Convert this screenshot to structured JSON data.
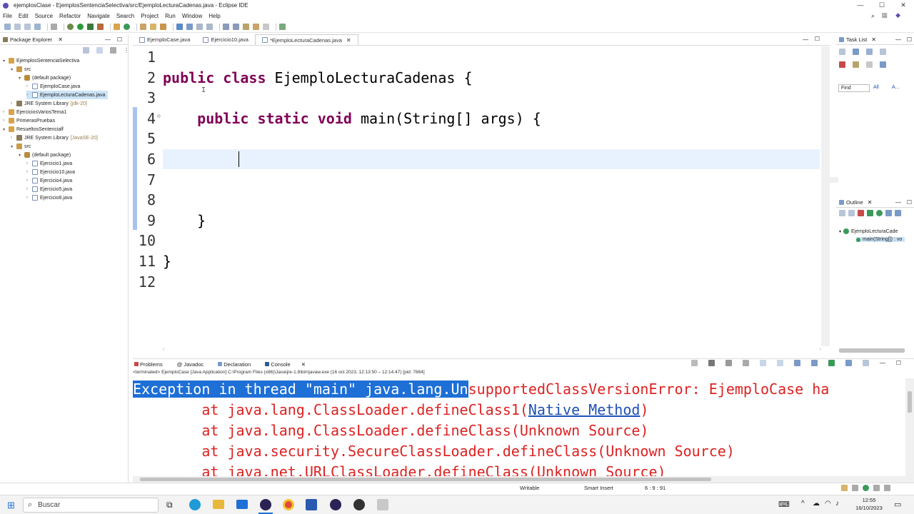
{
  "window": {
    "title": "ejemplosClase - EjemplosSentenciaSelectiva/src/EjemploLecturaCadenas.java - Eclipse IDE",
    "controls": [
      "—",
      "☐",
      "✕"
    ]
  },
  "menu": [
    "File",
    "Edit",
    "Source",
    "Refactor",
    "Navigate",
    "Search",
    "Project",
    "Run",
    "Window",
    "Help"
  ],
  "package_explorer": {
    "title": "Package Explorer",
    "tree": [
      {
        "label": "EjemplosSentenciaSelectiva",
        "depth": 0,
        "icon": "project",
        "expanded": true
      },
      {
        "label": "src",
        "depth": 1,
        "icon": "src",
        "expanded": true
      },
      {
        "label": "(default package)",
        "depth": 2,
        "icon": "package",
        "expanded": true
      },
      {
        "label": "EjemploCase.java",
        "depth": 3,
        "icon": "file",
        "expanded": false
      },
      {
        "label": "EjemploLecturaCadenas.java",
        "depth": 3,
        "icon": "file",
        "expanded": false,
        "selected": true
      },
      {
        "label": "JRE System Library",
        "suffix": "[jdk-20]",
        "depth": 1,
        "icon": "lib",
        "expanded": false
      },
      {
        "label": "EjerciciosVariosTema1",
        "depth": 0,
        "icon": "project",
        "expanded": false
      },
      {
        "label": "PrimerasPruebas",
        "depth": 0,
        "icon": "project",
        "expanded": false
      },
      {
        "label": "ResueltosSentencialf",
        "depth": 0,
        "icon": "project",
        "expanded": true
      },
      {
        "label": "JRE System Library",
        "suffix": "[JavaSE-20]",
        "depth": 1,
        "icon": "lib",
        "expanded": false
      },
      {
        "label": "src",
        "depth": 1,
        "icon": "src",
        "expanded": true
      },
      {
        "label": "(default package)",
        "depth": 2,
        "icon": "package",
        "expanded": true
      },
      {
        "label": "Ejercicio1.java",
        "depth": 3,
        "icon": "file",
        "expanded": false
      },
      {
        "label": "Ejercicio10.java",
        "depth": 3,
        "icon": "file",
        "expanded": false
      },
      {
        "label": "Ejercicio4.java",
        "depth": 3,
        "icon": "file",
        "expanded": false
      },
      {
        "label": "Ejercicio5.java",
        "depth": 3,
        "icon": "file",
        "expanded": false
      },
      {
        "label": "Ejercicio8.java",
        "depth": 3,
        "icon": "file",
        "expanded": false
      }
    ]
  },
  "editor": {
    "tabs": [
      {
        "label": "EjemploCase.java",
        "active": false
      },
      {
        "label": "Ejercicio10.java",
        "active": false
      },
      {
        "label": "*EjemploLecturaCadenas.java",
        "active": true
      }
    ],
    "lines": [
      {
        "n": "1",
        "code": ""
      },
      {
        "n": "2",
        "code": "public class EjemploLecturaCadenas {"
      },
      {
        "n": "3",
        "code": ""
      },
      {
        "n": "4",
        "code": "    public static void main(String[] args) {"
      },
      {
        "n": "5",
        "code": ""
      },
      {
        "n": "6",
        "code": ""
      },
      {
        "n": "7",
        "code": ""
      },
      {
        "n": "8",
        "code": ""
      },
      {
        "n": "9",
        "code": "    }"
      },
      {
        "n": "10",
        "code": ""
      },
      {
        "n": "11",
        "code": "}"
      },
      {
        "n": "12",
        "code": ""
      }
    ]
  },
  "task_list": {
    "title": "Task List",
    "find_placeholder": "Find",
    "all_label": "All",
    "a_label": "A..."
  },
  "outline": {
    "title": "Outline",
    "class_label": "EjemploLecturaCade",
    "method_label": "main(String[]) : vo"
  },
  "console": {
    "tabs": [
      "Problems",
      "Javadoc",
      "Declaration",
      "Console"
    ],
    "info": "<terminated> EjemploCase [Java Application] C:\\Program Files (x86)\\Java\\jre-1.8\\bin\\javaw.exe  (16 oct 2023, 12:13:50 – 12:14:47) [pid: 7864]",
    "line1_highlight": "Exception in thread \"main\" java.lang.Un",
    "line1_rest": "supportedClassVersionError: EjemploCase ha",
    "line2_pre": "        at java.lang.ClassLoader.defineClass1(",
    "line2_link": "Native Method",
    "line2_post": ")",
    "line3": "        at java.lang.ClassLoader.defineClass(Unknown Source)",
    "line4": "        at java.security.SecureClassLoader.defineClass(Unknown Source)",
    "line5": "        at java.net.URLClassLoader.defineClass(Unknown Source)"
  },
  "status": {
    "writable": "Writable",
    "insert": "Smart Insert",
    "position": "6 : 9 : 91"
  },
  "taskbar": {
    "search_label": "Buscar",
    "time": "12:55",
    "date": "16/10/2023"
  }
}
